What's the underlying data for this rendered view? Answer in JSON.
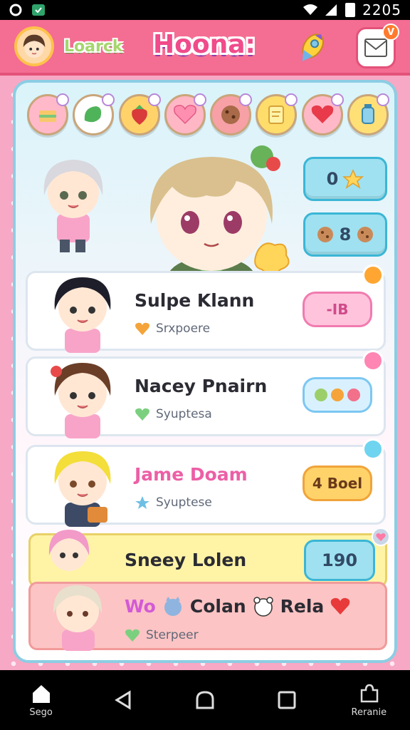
{
  "status_bar": {
    "time": "2205"
  },
  "header": {
    "user_label": "Loarck",
    "title": "Hoona:",
    "mail_badge": "V"
  },
  "stickers": [
    {
      "icon": "sandwich-icon",
      "color": "#ffb9c9"
    },
    {
      "icon": "leaf-icon",
      "color": "#ffffff"
    },
    {
      "icon": "strawberry-icon",
      "color": "#ffd36a"
    },
    {
      "icon": "heart-icon",
      "color": "#ffb7c5"
    },
    {
      "icon": "cookie-icon",
      "color": "#f7a0a6"
    },
    {
      "icon": "note-icon",
      "color": "#ffdd6b"
    },
    {
      "icon": "red-heart-icon",
      "color": "#ffb8c8"
    },
    {
      "icon": "bottle-icon",
      "color": "#ffe077"
    }
  ],
  "featured": {
    "stat_top": "0",
    "stat_bottom": "8"
  },
  "cards": [
    {
      "name": "Sulpe Klann",
      "sub": "Srxpoere",
      "bubble": "-IB",
      "heart_color": "#f4a43a",
      "bubble_bg": "#ffc4dc",
      "bubble_border": "#f17bb0",
      "corner_color": "#ffa632"
    },
    {
      "name": "Nacey Pnairn",
      "sub": "Syuptesa",
      "bubble": "",
      "heart_color": "#7bd07f",
      "bubble_bg": "#d9f1ff",
      "bubble_border": "#7cc7f2",
      "corner_color": "#ff85b3"
    },
    {
      "name": "Jame Doam",
      "sub": "Syuptese",
      "bubble": "4 Boel",
      "heart_color": "#6fbfe4",
      "bubble_bg": "#ffd36a",
      "bubble_border": "#f0a43a",
      "corner_color": "#6fd4f0"
    }
  ],
  "yellow_card": {
    "name": "Sneey Lolen",
    "value": "190"
  },
  "pink_card": {
    "name_a": "Wo",
    "name_b": "Colan",
    "name_c": "Rela",
    "sub": "Sterpeer"
  },
  "nav": {
    "home_label": "Sego",
    "profile_label": "Reranie"
  }
}
